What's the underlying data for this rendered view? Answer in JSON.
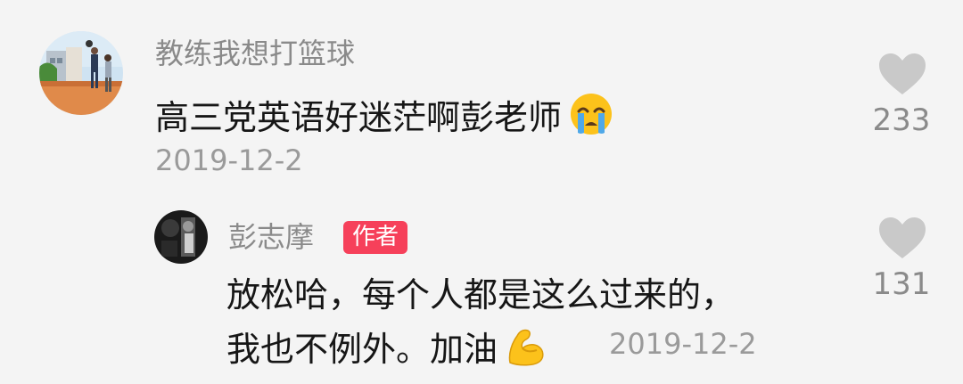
{
  "comment": {
    "username": "教练我想打篮球",
    "text": "高三党英语好迷茫啊彭老师",
    "emoji": "crying-face-emoji",
    "date": "2019-12-2",
    "likes": "233"
  },
  "reply": {
    "username": "彭志摩",
    "badge": "作者",
    "text_line1": "放松哈，每个人都是这么过来的，",
    "text_line2": "我也不例外。加油",
    "emoji": "flexed-biceps-emoji",
    "date": "2019-12-2",
    "likes": "131"
  },
  "colors": {
    "background": "#f4f4f4",
    "badge": "#f6405a",
    "text_primary": "#161616",
    "text_secondary": "#8a8a8a"
  }
}
